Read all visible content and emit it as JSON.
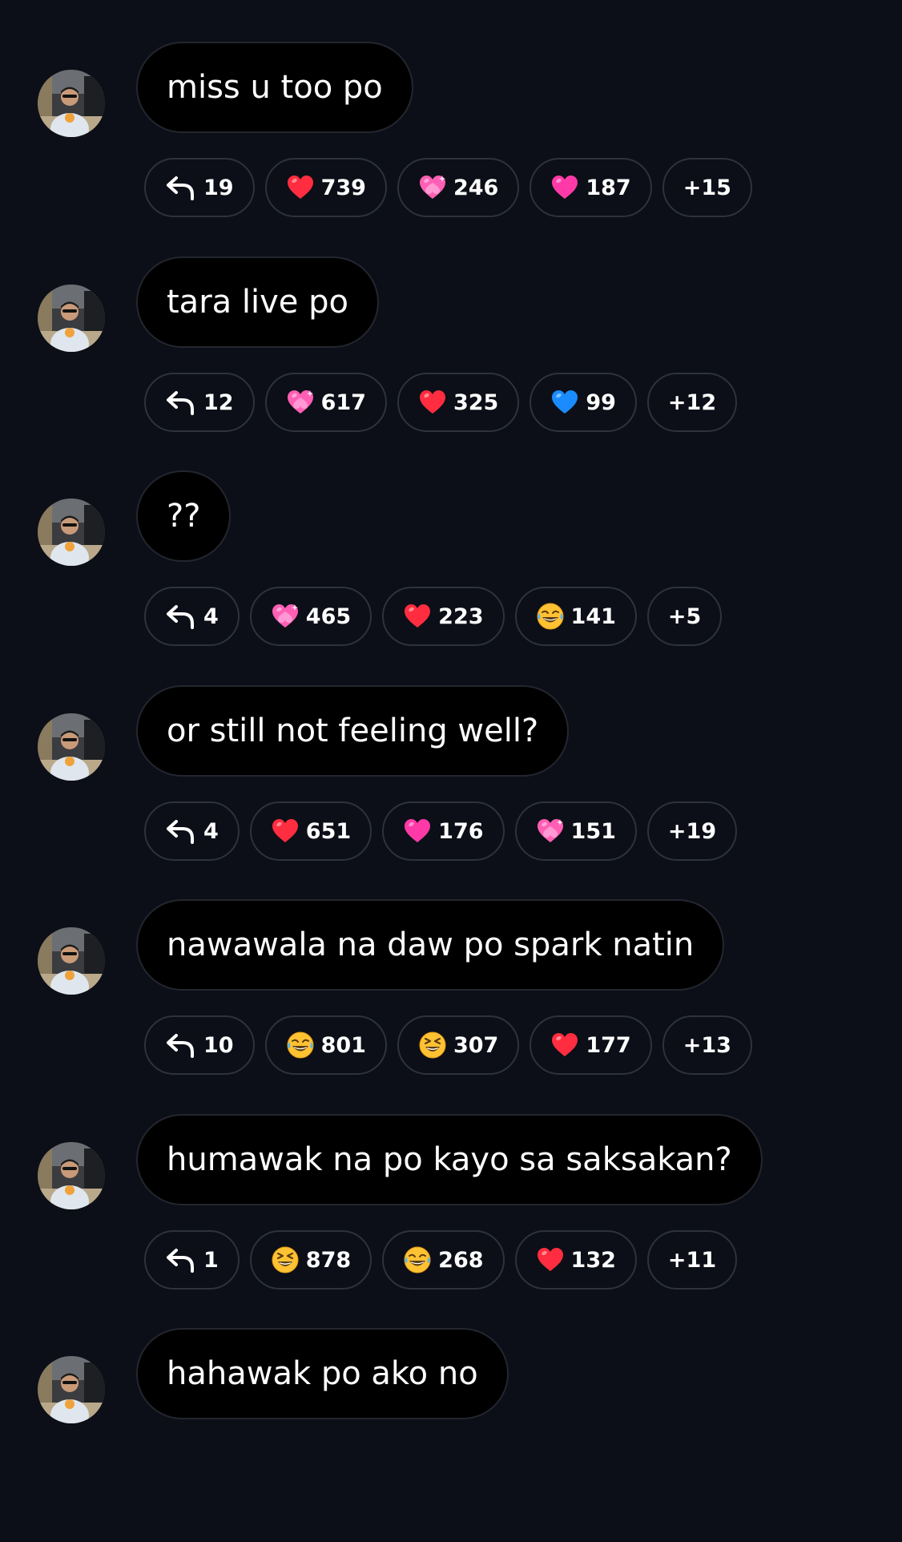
{
  "messages": [
    {
      "text": "miss u too po",
      "replies": "19",
      "reactions": [
        {
          "icon": "red-heart-icon",
          "count": "739"
        },
        {
          "icon": "sparkling-heart-icon",
          "count": "246"
        },
        {
          "icon": "pink-heart-icon",
          "count": "187"
        }
      ],
      "more": "+15"
    },
    {
      "text": "tara live po",
      "replies": "12",
      "reactions": [
        {
          "icon": "sparkling-heart-icon",
          "count": "617"
        },
        {
          "icon": "red-heart-icon",
          "count": "325"
        },
        {
          "icon": "blue-heart-icon",
          "count": "99"
        }
      ],
      "more": "+12"
    },
    {
      "text": "??",
      "replies": "4",
      "reactions": [
        {
          "icon": "sparkling-heart-icon",
          "count": "465"
        },
        {
          "icon": "red-heart-icon",
          "count": "223"
        },
        {
          "icon": "tears-of-joy-icon",
          "count": "141"
        }
      ],
      "more": "+5"
    },
    {
      "text": "or still not feeling well?",
      "replies": "4",
      "reactions": [
        {
          "icon": "red-heart-icon",
          "count": "651"
        },
        {
          "icon": "pink-heart-icon",
          "count": "176"
        },
        {
          "icon": "sparkling-heart-icon",
          "count": "151"
        }
      ],
      "more": "+19"
    },
    {
      "text": "nawawala na daw po spark natin",
      "replies": "10",
      "reactions": [
        {
          "icon": "tears-of-joy-icon",
          "count": "801"
        },
        {
          "icon": "squinting-laugh-icon",
          "count": "307"
        },
        {
          "icon": "red-heart-icon",
          "count": "177"
        }
      ],
      "more": "+13"
    },
    {
      "text": "humawak na po kayo sa saksakan?",
      "replies": "1",
      "reactions": [
        {
          "icon": "squinting-laugh-icon",
          "count": "878"
        },
        {
          "icon": "tears-of-joy-icon",
          "count": "268"
        },
        {
          "icon": "red-heart-icon",
          "count": "132"
        }
      ],
      "more": "+11"
    },
    {
      "text": "hahawak po ako no",
      "replies": "",
      "reactions": [],
      "more": ""
    }
  ],
  "colors": {
    "background": "#0c0f17",
    "bubble": "#000000",
    "pill_border": "#2e323b",
    "red_heart": "#ff2d3f",
    "pink_heart": "#ff3aa8",
    "sparkling_heart": "#ff5fb5",
    "blue_heart": "#1a8cff",
    "laugh_face": "#ffc233"
  }
}
